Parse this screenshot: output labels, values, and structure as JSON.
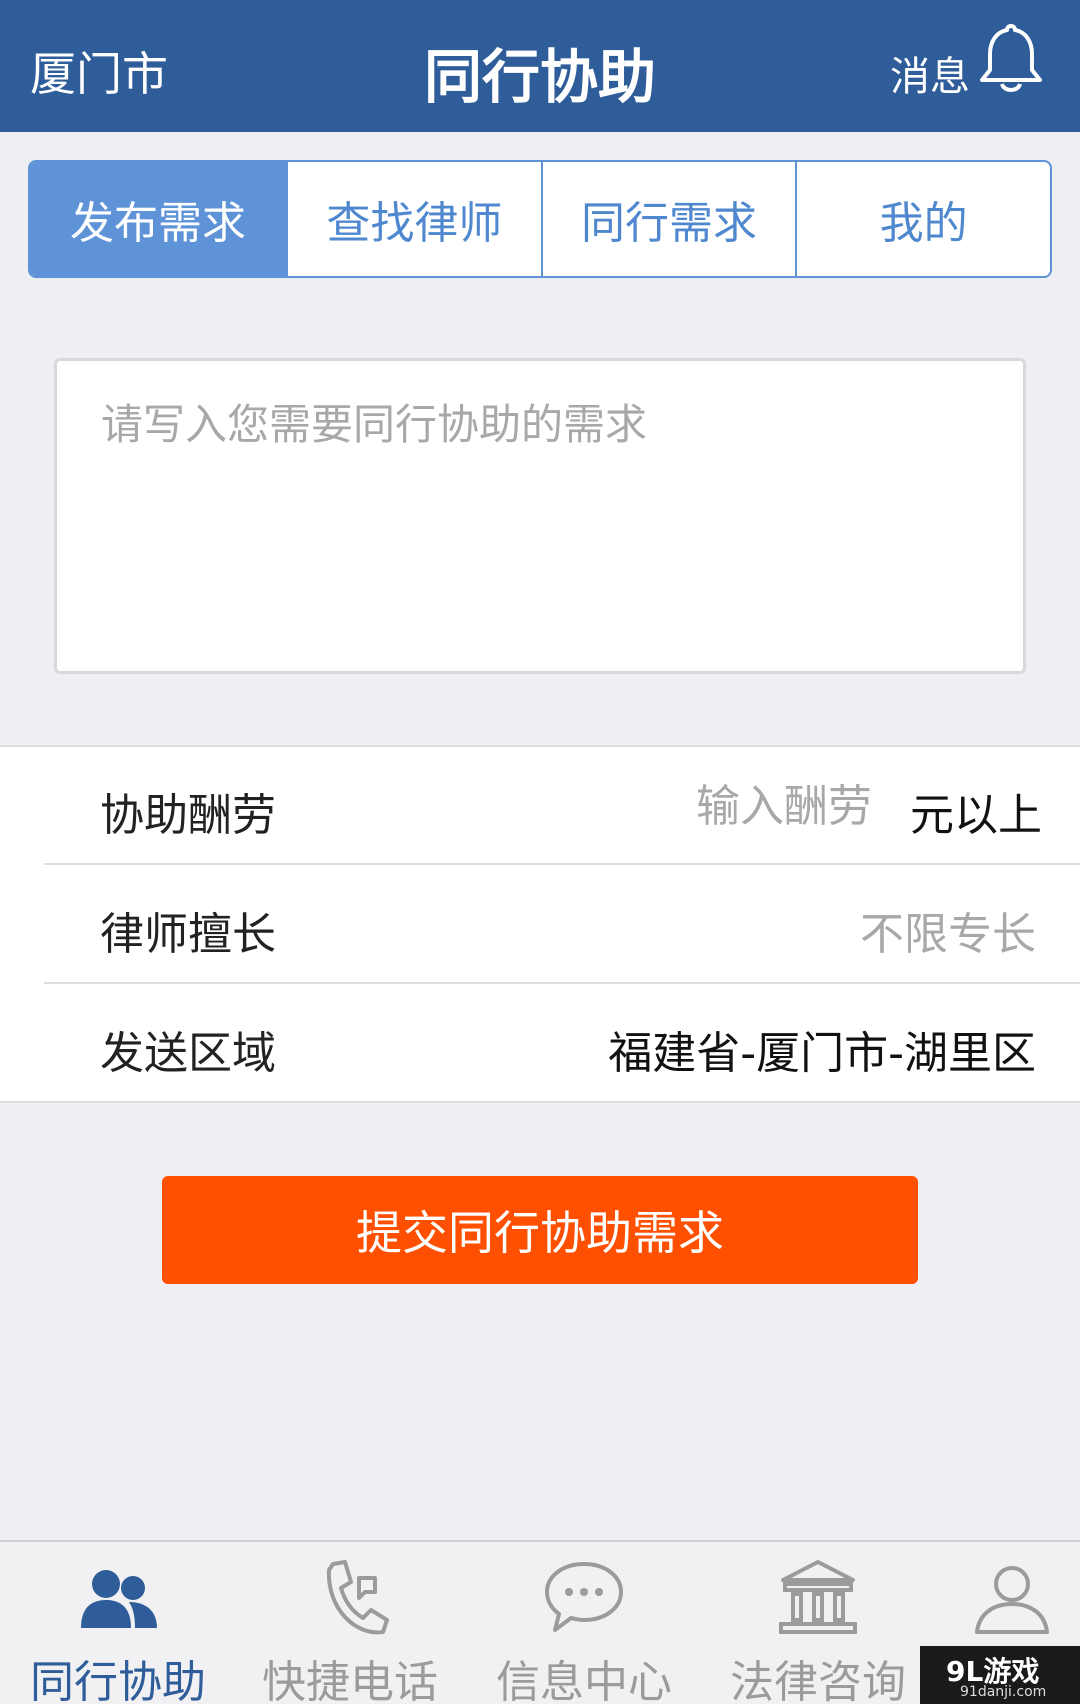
{
  "header": {
    "city": "厦门市",
    "title": "同行协助",
    "messages_label": "消息"
  },
  "tabs": [
    {
      "label": "发布需求",
      "active": true
    },
    {
      "label": "查找律师",
      "active": false
    },
    {
      "label": "同行需求",
      "active": false
    },
    {
      "label": "我的",
      "active": false
    }
  ],
  "request": {
    "placeholder": "请写入您需要同行协助的需求"
  },
  "form": {
    "reward": {
      "label": "协助酬劳",
      "placeholder": "输入酬劳",
      "unit": "元以上"
    },
    "specialty": {
      "label": "律师擅长",
      "value": "不限专长"
    },
    "region": {
      "label": "发送区域",
      "value": "福建省-厦门市-湖里区"
    }
  },
  "submit_label": "提交同行协助需求",
  "bottom_nav": [
    {
      "label": "同行协助",
      "icon": "users-icon",
      "active": true
    },
    {
      "label": "快捷电话",
      "icon": "phone-icon",
      "active": false
    },
    {
      "label": "信息中心",
      "icon": "chat-bubble-icon",
      "active": false
    },
    {
      "label": "法律咨询",
      "icon": "courthouse-icon",
      "active": false
    },
    {
      "label": "",
      "icon": "user-profile-icon",
      "active": false
    }
  ],
  "watermark": {
    "main": "9L游戏",
    "sub": "91danji.com"
  },
  "colors": {
    "header": "#2f5d9a",
    "tab_accent": "#5e93d8",
    "submit": "#ff4f00",
    "background": "#eeeff3"
  }
}
